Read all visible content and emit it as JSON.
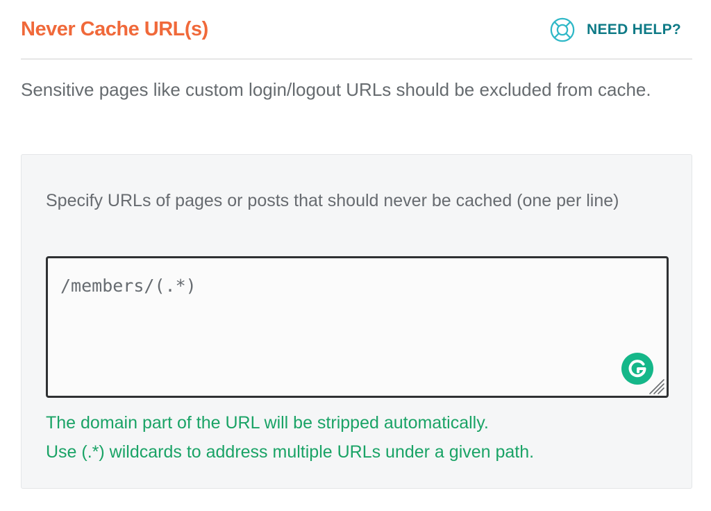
{
  "colors": {
    "title": "#f0693a",
    "help": "#0e7a86",
    "help_icon": "#2fb8c7",
    "hint": "#1aa366",
    "grammarly": "#15b789",
    "input_text": "#666b70"
  },
  "section": {
    "title": "Never Cache URL(s)",
    "help_label": "NEED HELP?",
    "help_icon": "lifebuoy-icon",
    "description": "Sensitive pages like custom login/logout URLs should be excluded from cache."
  },
  "field": {
    "label": "Specify URLs of pages or posts that should never be cached (one per line)",
    "value": "/members/(.*)",
    "grammarly_icon": "grammarly-icon",
    "resize_icon": "resize-handle-icon"
  },
  "hints": [
    "The domain part of the URL will be stripped automatically.",
    "Use (.*) wildcards to address multiple URLs under a given path."
  ]
}
